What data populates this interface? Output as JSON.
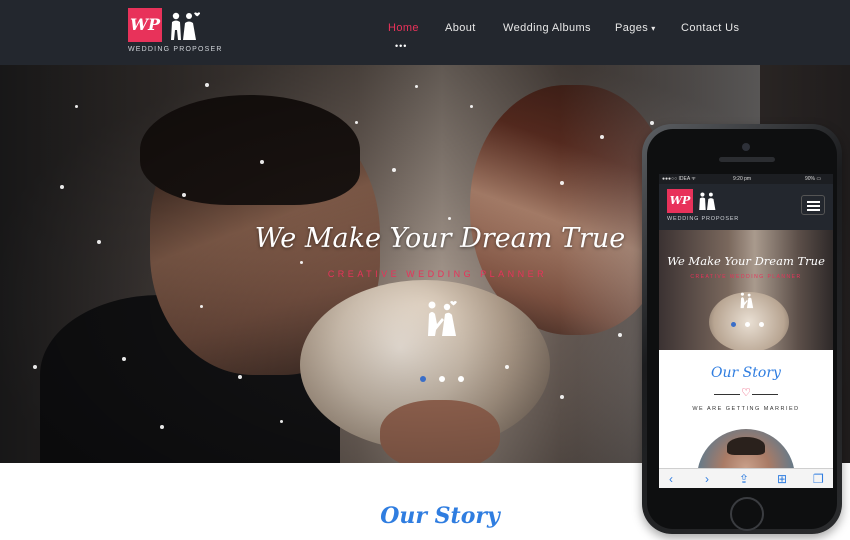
{
  "brand": {
    "logo_initials": "WP",
    "logo_text": "WEDDING PROPOSER"
  },
  "nav": {
    "items": [
      {
        "label": "Home",
        "active": true
      },
      {
        "label": "About"
      },
      {
        "label": "Wedding Albums"
      },
      {
        "label": "Pages",
        "has_dropdown": true
      },
      {
        "label": "Contact Us"
      }
    ],
    "active_indicator": "•••",
    "dropdown_caret": "▾"
  },
  "hero": {
    "title": "We Make Your Dream True",
    "subtitle": "CREATIVE WEDDING PLANNER",
    "slider_dots": 3,
    "active_slide": 1
  },
  "story": {
    "title": "Our Story"
  },
  "mobile": {
    "status_carrier": "●●●○○ IDEA ᯤ",
    "status_time": "9:20 pm",
    "status_battery": "90% ▭",
    "logo_initials": "WP",
    "logo_text": "WEDDING PROPOSER",
    "hero_title": "We Make Your Dream True",
    "hero_subtitle": "CREATIVE WEDDING PLANNER",
    "story_title": "Our Story",
    "heart": "♡",
    "tagline": "WE ARE GETTING MARRIED",
    "toolbar": {
      "back": "‹",
      "forward": "›",
      "share": "⇪",
      "bookmarks": "⊞",
      "tabs": "❐"
    }
  },
  "colors": {
    "accent_pink": "#e8325a",
    "header_bg": "#23272e",
    "story_blue": "#2f7de0",
    "active_dot": "#3a6ec8"
  },
  "icons": [
    "couple-logo-icon",
    "couple-silhouette-icon",
    "hamburger-menu-icon",
    "heart-icon",
    "back-arrow-icon",
    "forward-arrow-icon",
    "share-icon",
    "bookmarks-icon",
    "tabs-icon"
  ]
}
